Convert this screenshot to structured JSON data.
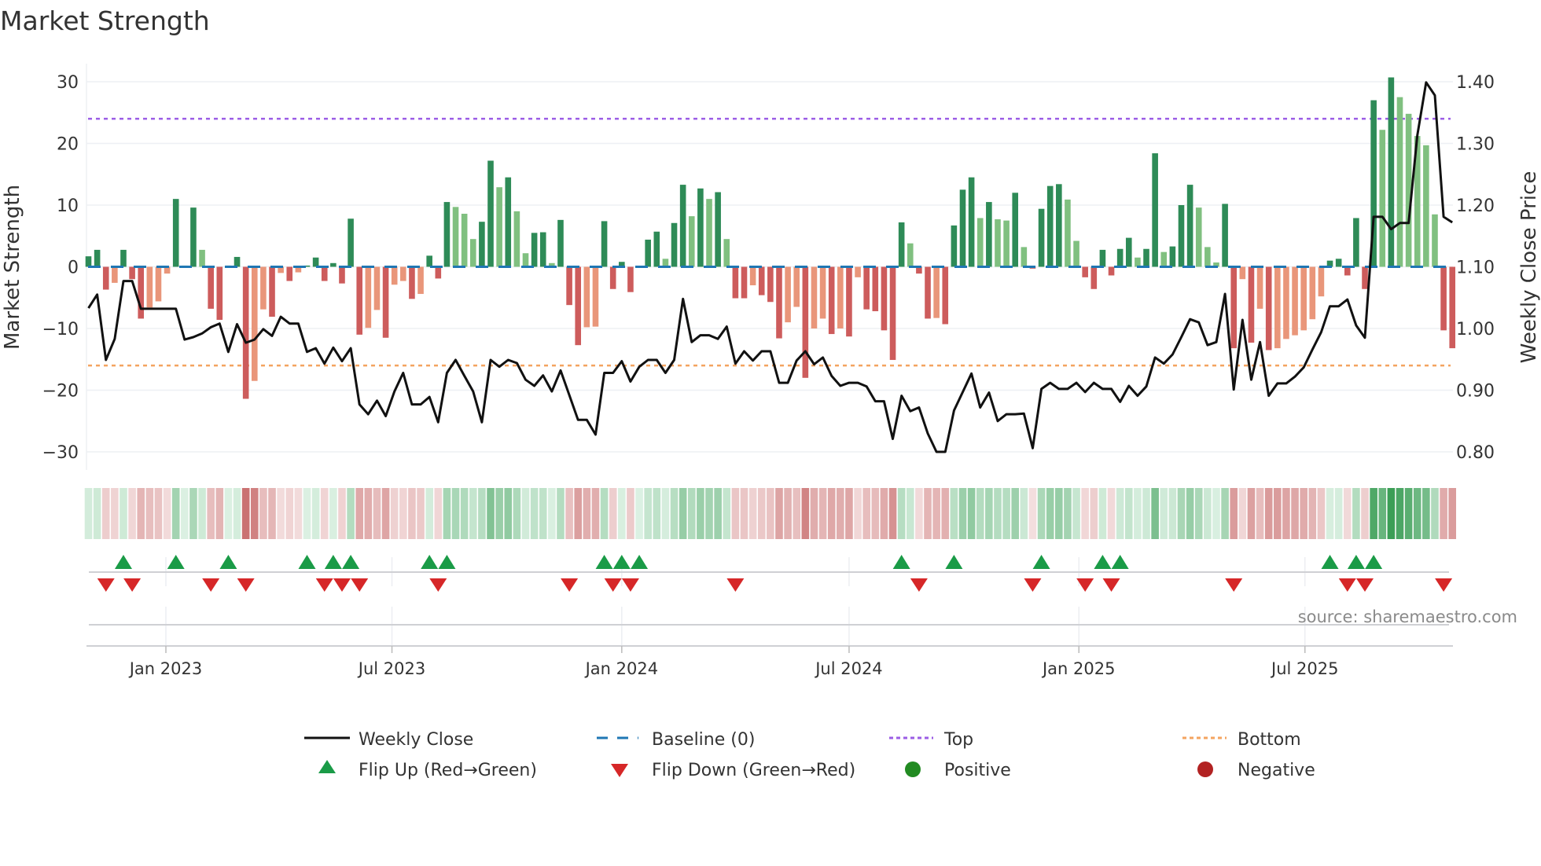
{
  "title": "Market Strength",
  "source": "source: sharemaestro.com",
  "colors": {
    "bar_up_strong": "#2e8b57",
    "bar_up_weak": "#80c080",
    "bar_down_strong": "#cd5c5c",
    "bar_down_weak": "#e9967a",
    "close_line": "#111111",
    "baseline": "#1f77b4",
    "top": "#9b5de5",
    "bottom": "#f4a460",
    "flip_up": "#1a9b47",
    "flip_down": "#d62728",
    "positive": "#228b22",
    "negative": "#b22222"
  },
  "chart_data": {
    "type": "bar",
    "title": "Market Strength",
    "x_start": "2022-10-31",
    "x_step_days": 7,
    "ylabel": "Market Strength",
    "ylabel_right": "Weekly Close Price",
    "ylim": [
      -33,
      33
    ],
    "ylim_right": [
      0.77,
      1.43
    ],
    "yticks": [
      "30",
      "20",
      "10",
      "0",
      "−10",
      "−20",
      "−30"
    ],
    "ytick_values": [
      30,
      20,
      10,
      0,
      -10,
      -20,
      -30
    ],
    "yticks_right": [
      "1.40",
      "1.30",
      "1.20",
      "1.10",
      "1.00",
      "0.90",
      "0.80"
    ],
    "ytick_right_values": [
      1.4,
      1.3,
      1.2,
      1.1,
      1.0,
      0.9,
      0.8
    ],
    "xticks": [
      {
        "label": "Jan 2023",
        "date": "2023-01-01"
      },
      {
        "label": "Jul 2023",
        "date": "2023-07-01"
      },
      {
        "label": "Jan 2024",
        "date": "2024-01-01"
      },
      {
        "label": "Jul 2024",
        "date": "2024-07-01"
      },
      {
        "label": "Jan 2025",
        "date": "2025-01-01"
      },
      {
        "label": "Jul 2025",
        "date": "2025-07-01"
      }
    ],
    "grid": true,
    "baseline": 0,
    "top": 24,
    "bottom": -16,
    "strength": [
      1.7,
      2.75,
      -3.7,
      -2.6,
      2.75,
      -2.0,
      -8.4,
      -6.6,
      -5.6,
      -1.1,
      11.0,
      0.2,
      9.6,
      2.75,
      -6.8,
      -8.6,
      0.2,
      1.6,
      -21.4,
      -18.5,
      -6.9,
      -8.1,
      -1.0,
      -2.3,
      -0.9,
      0.2,
      1.5,
      -2.3,
      0.6,
      -2.7,
      7.8,
      -11.0,
      -9.9,
      -7.0,
      -11.5,
      -2.9,
      -2.3,
      -5.2,
      -4.4,
      1.8,
      -1.9,
      10.5,
      9.7,
      8.6,
      4.5,
      7.3,
      17.2,
      12.9,
      14.5,
      9.0,
      2.2,
      5.5,
      5.6,
      0.6,
      7.6,
      -6.2,
      -12.7,
      -9.8,
      -9.7,
      7.4,
      -3.6,
      0.8,
      -4.1,
      0.1,
      4.4,
      5.7,
      1.3,
      7.1,
      13.3,
      8.2,
      12.7,
      11.0,
      12.1,
      4.5,
      -5.1,
      -5.1,
      -3.0,
      -4.6,
      -5.7,
      -11.6,
      -9.0,
      -6.5,
      -18.0,
      -10.0,
      -8.4,
      -10.9,
      -10.0,
      -11.3,
      -1.7,
      -6.9,
      -7.2,
      -10.3,
      -15.1,
      7.2,
      3.8,
      -1.1,
      -8.4,
      -8.3,
      -9.3,
      6.7,
      12.5,
      14.5,
      7.9,
      10.5,
      7.7,
      7.5,
      12.0,
      3.2,
      -0.3,
      9.4,
      13.1,
      13.4,
      10.9,
      4.2,
      -1.7,
      -3.6,
      2.75,
      -1.4,
      2.9,
      4.7,
      1.5,
      2.9,
      18.4,
      2.4,
      3.3,
      10.0,
      13.3,
      9.6,
      3.2,
      0.7,
      10.2,
      -13.2,
      -2.0,
      -12.3,
      -6.8,
      -13.5,
      -13.2,
      -11.7,
      -11.1,
      -10.3,
      -8.5,
      -4.8,
      1.0,
      1.3,
      -1.4,
      7.9,
      -3.6,
      27.0,
      22.2,
      30.7,
      27.5,
      24.8,
      21.2,
      19.7,
      8.5,
      -10.3,
      -13.2
    ],
    "weekly_close": [
      1.033,
      1.055,
      0.949,
      0.983,
      1.077,
      1.077,
      1.032,
      1.032,
      1.032,
      1.032,
      1.032,
      0.982,
      0.986,
      0.992,
      1.002,
      1.008,
      0.962,
      1.007,
      0.977,
      0.982,
      0.999,
      0.988,
      1.019,
      1.008,
      1.008,
      0.962,
      0.968,
      0.943,
      0.969,
      0.947,
      0.968,
      0.877,
      0.861,
      0.883,
      0.858,
      0.898,
      0.928,
      0.877,
      0.877,
      0.889,
      0.848,
      0.928,
      0.949,
      0.923,
      0.898,
      0.848,
      0.949,
      0.938,
      0.949,
      0.944,
      0.917,
      0.907,
      0.924,
      0.898,
      0.932,
      0.892,
      0.852,
      0.852,
      0.828,
      0.928,
      0.928,
      0.947,
      0.914,
      0.938,
      0.949,
      0.949,
      0.928,
      0.949,
      1.048,
      0.978,
      0.989,
      0.989,
      0.983,
      1.003,
      0.943,
      0.963,
      0.948,
      0.963,
      0.963,
      0.912,
      0.912,
      0.948,
      0.963,
      0.942,
      0.953,
      0.923,
      0.907,
      0.912,
      0.912,
      0.906,
      0.882,
      0.882,
      0.821,
      0.891,
      0.866,
      0.872,
      0.83,
      0.8,
      0.8,
      0.867,
      0.897,
      0.927,
      0.872,
      0.896,
      0.85,
      0.861,
      0.861,
      0.862,
      0.806,
      0.902,
      0.912,
      0.902,
      0.902,
      0.912,
      0.897,
      0.912,
      0.902,
      0.902,
      0.881,
      0.907,
      0.891,
      0.906,
      0.953,
      0.943,
      0.958,
      0.986,
      1.015,
      1.01,
      0.973,
      0.978,
      1.056,
      0.901,
      1.014,
      0.917,
      0.978,
      0.891,
      0.911,
      0.911,
      0.922,
      0.937,
      0.966,
      0.994,
      1.036,
      1.036,
      1.047,
      1.005,
      0.985,
      1.181,
      1.181,
      1.161,
      1.171,
      1.171,
      1.313,
      1.399,
      1.378,
      1.181,
      1.172
    ],
    "legend": {
      "placement": "bottom",
      "weekly_close": "Weekly Close",
      "baseline": "Baseline (0)",
      "top": "Top",
      "bottom": "Bottom",
      "flip_up": "Flip Up (Red→Green)",
      "flip_down": "Flip Down (Green→Red)",
      "positive": "Positive",
      "negative": "Negative"
    }
  }
}
